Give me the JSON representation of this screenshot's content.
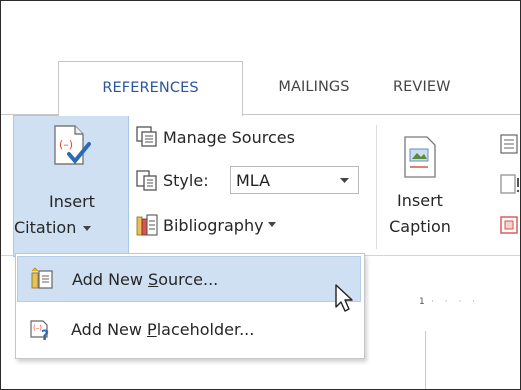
{
  "tabs": {
    "references": "REFERENCES",
    "mailings": "MAILINGS",
    "review": "REVIEW"
  },
  "ribbon": {
    "insert_citation_line1": "Insert",
    "insert_citation_line2": "Citation",
    "manage_sources": "Manage Sources",
    "style_label": "Style:",
    "style_value": "MLA",
    "bibliography": "Bibliography",
    "insert_caption_line1": "Insert",
    "insert_caption_line2": "Caption"
  },
  "menu": {
    "add_new_source_prefix": "Add New ",
    "add_new_source_underline": "S",
    "add_new_source_suffix": "ource...",
    "add_new_placeholder_prefix": "Add New ",
    "add_new_placeholder_underline": "P",
    "add_new_placeholder_suffix": "laceholder..."
  },
  "ruler": {
    "mark": "1"
  },
  "colors": {
    "active_tab_text": "#2b579a",
    "highlight": "#cfe0f3",
    "checkmark": "#2b6bb5",
    "citation_icon_red": "#e0452d"
  },
  "icons": [
    "insert-citation-icon",
    "manage-sources-icon",
    "style-icon",
    "bibliography-icon",
    "insert-caption-icon",
    "add-source-icon",
    "add-placeholder-icon",
    "mouse-cursor-icon"
  ]
}
